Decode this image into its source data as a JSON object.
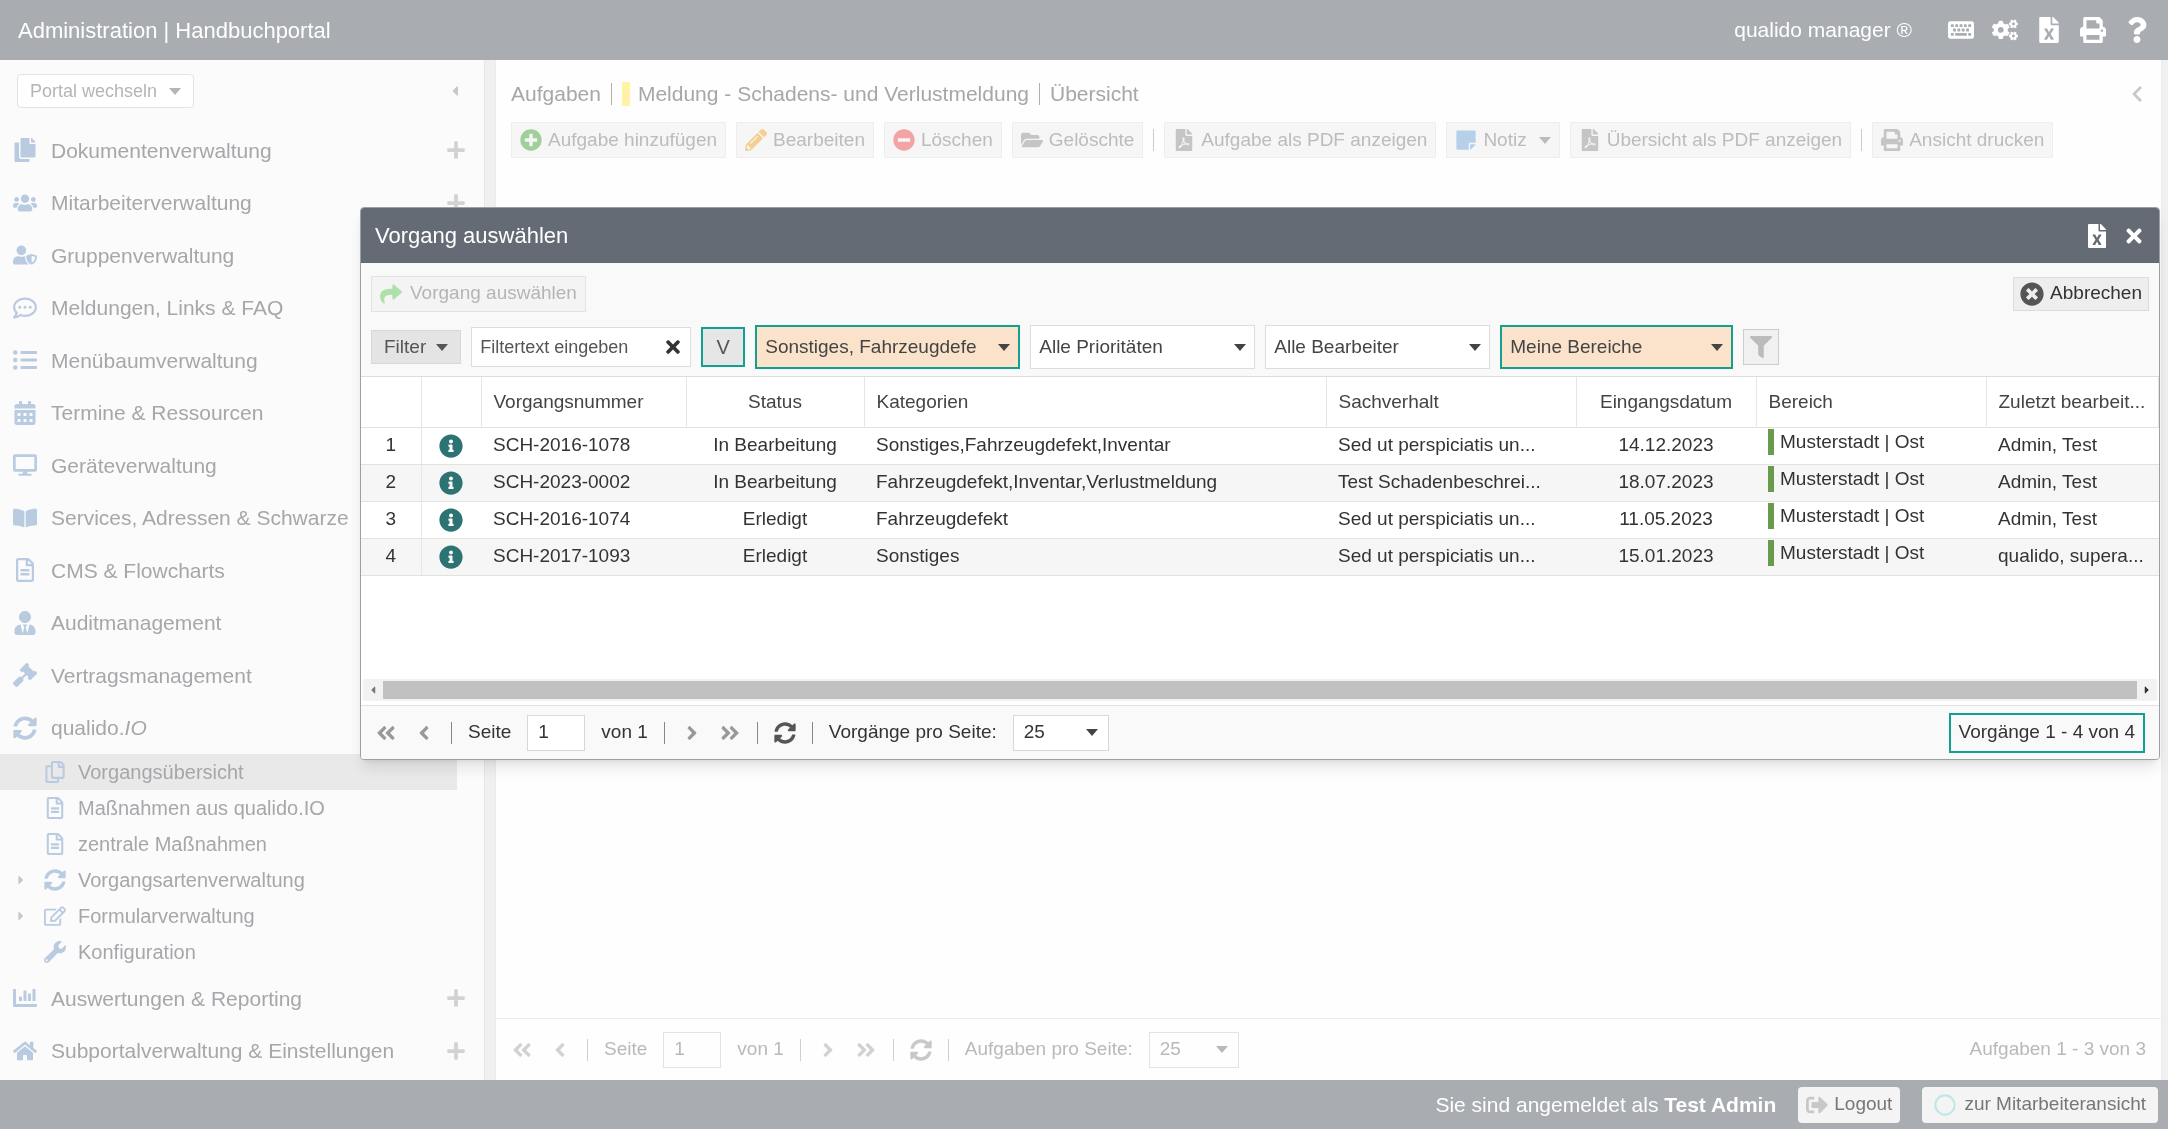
{
  "header": {
    "title": "Administration | Handbuchportal",
    "product": "qualido manager ®"
  },
  "sidebar": {
    "portal_switch": "Portal wechseln",
    "items": [
      {
        "label": "Dokumentenverwaltung",
        "expandable": true
      },
      {
        "label": "Mitarbeiterverwaltung",
        "expandable": true
      },
      {
        "label": "Gruppenverwaltung"
      },
      {
        "label": "Meldungen, Links & FAQ"
      },
      {
        "label": "Menübaumverwaltung"
      },
      {
        "label": "Termine & Ressourcen"
      },
      {
        "label": "Geräteverwaltung"
      },
      {
        "label": "Services, Adressen & Schwarze"
      },
      {
        "label": "CMS & Flowcharts"
      },
      {
        "label": "Auditmanagement"
      },
      {
        "label": "Vertragsmanagement"
      },
      {
        "label": "qualido.*IO*",
        "expandable": false,
        "children": [
          {
            "label": "Vorgangsübersicht",
            "selected": true,
            "has_children": false
          },
          {
            "label": "Maßnahmen aus qualido.IO",
            "selected": false,
            "has_children": false
          },
          {
            "label": "zentrale Maßnahmen",
            "selected": false,
            "has_children": false
          },
          {
            "label": "Vorgangsartenverwaltung",
            "selected": false,
            "has_children": true
          },
          {
            "label": "Formularverwaltung",
            "selected": false,
            "has_children": true
          },
          {
            "label": "Konfiguration",
            "selected": false,
            "has_children": false
          }
        ]
      },
      {
        "label": "Auswertungen & Reporting",
        "expandable": true
      },
      {
        "label": "Subportalverwaltung & Einstellungen",
        "expandable": true
      }
    ]
  },
  "breadcrumb": [
    "Aufgaben",
    "Meldung - Schadens- und Verlustmeldung",
    "Übersicht"
  ],
  "toolbar": [
    {
      "label": "Aufgabe hinzufügen",
      "dropdown": false
    },
    {
      "label": "Bearbeiten",
      "dropdown": false
    },
    {
      "label": "Löschen",
      "dropdown": false
    },
    {
      "label": "Gelöschte",
      "dropdown": false
    },
    {
      "label": "Aufgabe als PDF anzeigen",
      "dropdown": false
    },
    {
      "label": "Notiz",
      "dropdown": true
    },
    {
      "label": "Übersicht als PDF anzeigen",
      "dropdown": false
    },
    {
      "label": "Ansicht drucken",
      "dropdown": false
    }
  ],
  "pager": {
    "page_label": "Seite",
    "page": "1",
    "of": "von 1",
    "per_page_label": "Aufgaben pro Seite:",
    "per_page": "25",
    "summary": "Aufgaben 1 - 3 von 3"
  },
  "footer": {
    "login_text": "Sie sind angemeldet als **Test Admin**",
    "buttons": [
      "Logout",
      "zur Mitarbeiteransicht"
    ]
  },
  "dialog": {
    "title": "Vorgang auswählen",
    "select_button": {
      "label": "Vorgang auswählen",
      "disabled": true
    },
    "cancel_button": "Abbrechen",
    "filter_menu": "Filter",
    "filter_text": {
      "placeholder": "Filtertext eingeben"
    },
    "v_button": {
      "label": "V",
      "highlighted": true
    },
    "selects": [
      {
        "value": "Sonstiges, Fahrzeugdefe",
        "highlighted": true
      },
      {
        "value": "Alle Prioritäten",
        "highlighted": false
      },
      {
        "value": "Alle Bearbeiter",
        "highlighted": false
      },
      {
        "value": "Meine Bereiche",
        "highlighted": true
      }
    ],
    "table": {
      "columns": [
        "Vorgangsnummer",
        "Status",
        "Kategorien",
        "Sachverhalt",
        "Eingangsdatum",
        "Bereich",
        "Zuletzt bearbeit..."
      ],
      "rows": [
        {
          "number": "1",
          "id": "SCH-2016-1078",
          "status": "In Bearbeitung",
          "categories": "Sonstiges,Fahrzeugdefekt,Inventar",
          "facts": "Sed ut perspiciatis un...",
          "date": "14.12.2023",
          "area": "Musterstadt | Ost",
          "editor": "Admin, Test"
        },
        {
          "number": "2",
          "id": "SCH-2023-0002",
          "status": "In Bearbeitung",
          "categories": "Fahrzeugdefekt,Inventar,Verlustmeldung",
          "facts": "Test Schadenbeschrei...",
          "date": "18.07.2023",
          "area": "Musterstadt | Ost",
          "editor": "Admin, Test"
        },
        {
          "number": "3",
          "id": "SCH-2016-1074",
          "status": "Erledigt",
          "categories": "Fahrzeugdefekt",
          "facts": "Sed ut perspiciatis un...",
          "date": "11.05.2023",
          "area": "Musterstadt | Ost",
          "editor": "Admin, Test"
        },
        {
          "number": "4",
          "id": "SCH-2017-1093",
          "status": "Erledigt",
          "categories": "Sonstiges",
          "facts": "Sed ut perspiciatis un...",
          "date": "15.01.2023",
          "area": "Musterstadt | Ost",
          "editor": "qualido, supera..."
        }
      ]
    },
    "pager": {
      "page_label": "Seite",
      "page": "1",
      "of": "von 1",
      "per_page_label": "Vorgänge pro Seite:",
      "per_page": "25",
      "summary": {
        "text": "Vorgänge 1 - 4 von 4",
        "highlighted": true
      }
    }
  }
}
